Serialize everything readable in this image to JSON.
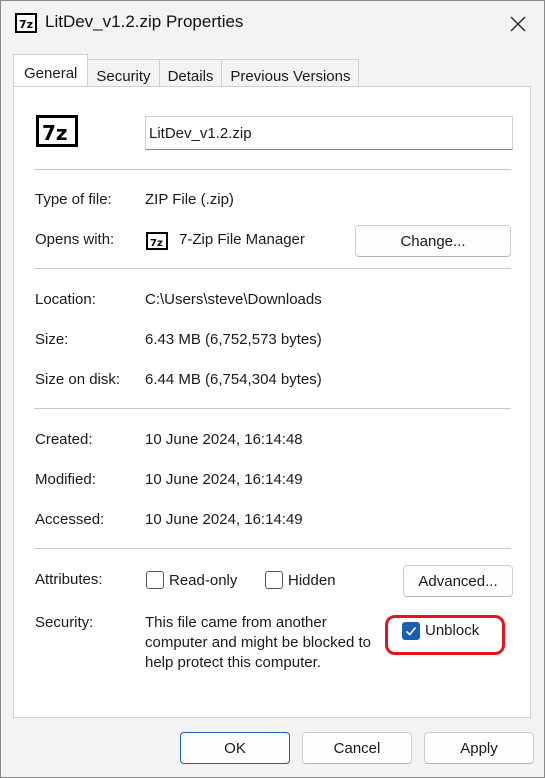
{
  "window": {
    "title": "LitDev_v1.2.zip Properties",
    "icon": "7z-icon"
  },
  "tabs": [
    {
      "label": "General",
      "active": true
    },
    {
      "label": "Security",
      "active": false
    },
    {
      "label": "Details",
      "active": false
    },
    {
      "label": "Previous Versions",
      "active": false
    }
  ],
  "general": {
    "file_name": "LitDev_v1.2.zip",
    "type_of_file_label": "Type of file:",
    "type_of_file": "ZIP File (.zip)",
    "opens_with_label": "Opens with:",
    "opens_with": "7-Zip File Manager",
    "change_button": "Change...",
    "location_label": "Location:",
    "location": "C:\\Users\\steve\\Downloads",
    "size_label": "Size:",
    "size": "6.43 MB (6,752,573 bytes)",
    "size_on_disk_label": "Size on disk:",
    "size_on_disk": "6.44 MB (6,754,304 bytes)",
    "created_label": "Created:",
    "created": "10 June 2024, 16:14:48",
    "modified_label": "Modified:",
    "modified": "10 June 2024, 16:14:49",
    "accessed_label": "Accessed:",
    "accessed": "10 June 2024, 16:14:49",
    "attributes_label": "Attributes:",
    "readonly_label": "Read-only",
    "readonly_checked": false,
    "hidden_label": "Hidden",
    "hidden_checked": false,
    "advanced_button": "Advanced...",
    "security_label": "Security:",
    "security_text_1": "This file came from another",
    "security_text_2": "computer and might be blocked to",
    "security_text_3": "help protect this computer.",
    "unblock_label": "Unblock",
    "unblock_checked": true
  },
  "footer": {
    "ok": "OK",
    "cancel": "Cancel",
    "apply": "Apply"
  },
  "colors": {
    "accent": "#1a5fb4",
    "highlight": "#e4141b"
  }
}
